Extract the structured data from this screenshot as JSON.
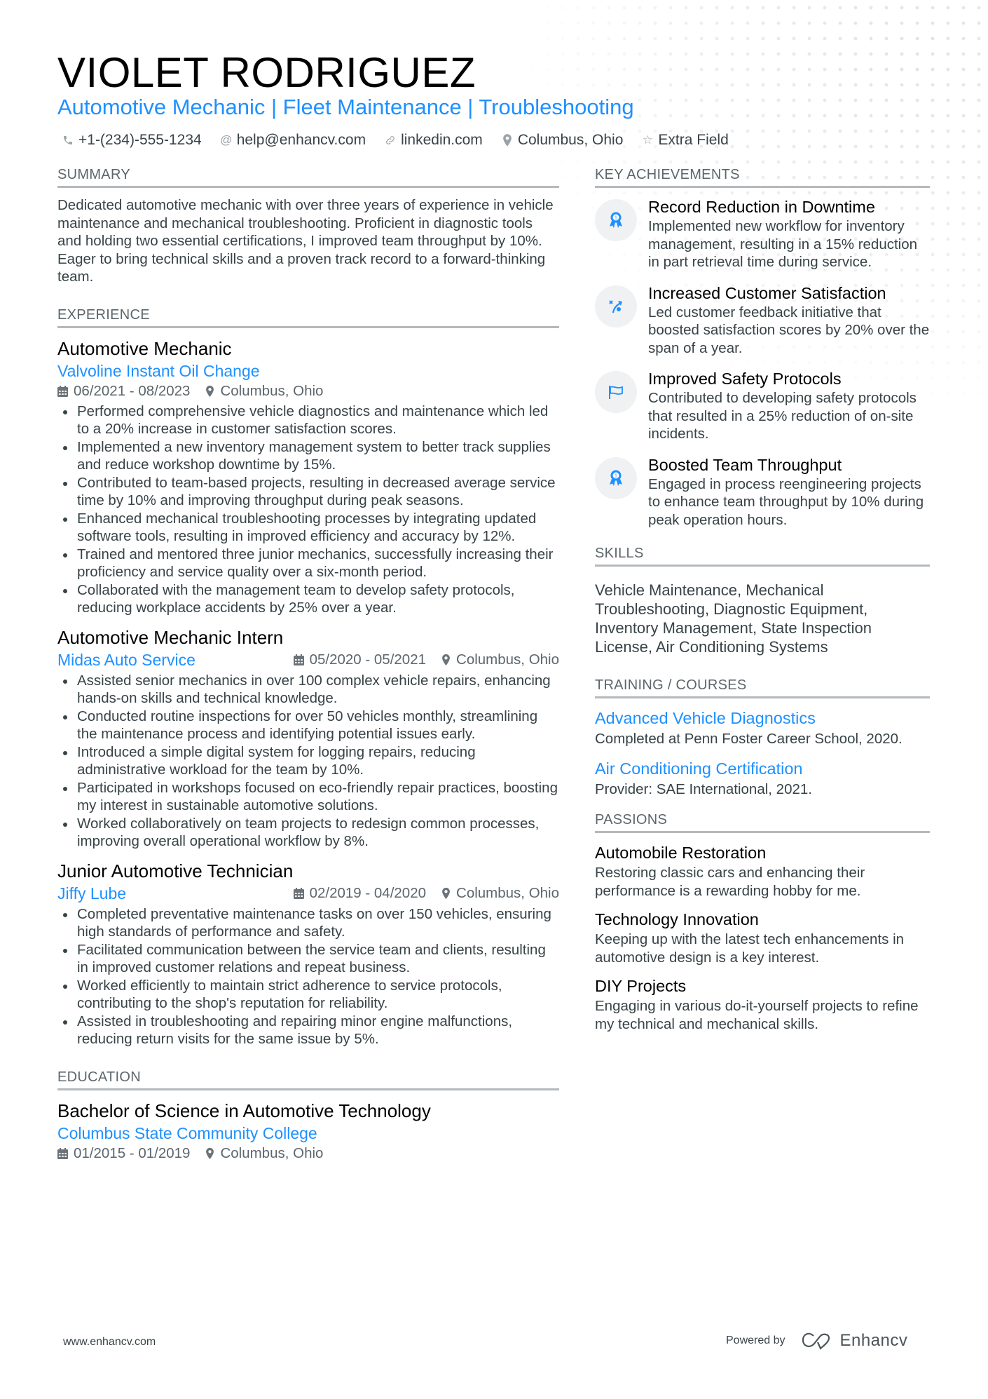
{
  "header": {
    "name": "VIOLET RODRIGUEZ",
    "headline": "Automotive Mechanic | Fleet Maintenance | Troubleshooting",
    "contacts": [
      {
        "icon": "phone-icon",
        "text": "+1-(234)-555-1234"
      },
      {
        "icon": "at-icon",
        "text": "help@enhancv.com"
      },
      {
        "icon": "link-icon",
        "text": "linkedin.com"
      },
      {
        "icon": "location-pin-icon",
        "text": "Columbus, Ohio"
      },
      {
        "icon": "star-icon",
        "text": "Extra Field"
      }
    ]
  },
  "colors": {
    "accent": "#1e90ff",
    "text": "#384347",
    "muted": "#5c666b",
    "rule": "#b5b9bc",
    "icon_bg": "#f0f1f2"
  },
  "summary": {
    "title": "SUMMARY",
    "text": "Dedicated automotive mechanic with over three years of experience in vehicle maintenance and mechanical troubleshooting. Proficient in diagnostic tools and holding two essential certifications, I improved team throughput by 10%. Eager to bring technical skills and a proven track record to a forward-thinking team."
  },
  "experience": {
    "title": "EXPERIENCE",
    "jobs": [
      {
        "title": "Automotive Mechanic",
        "company": "Valvoline Instant Oil Change",
        "dates": "06/2021 - 08/2023",
        "location": "Columbus, Ohio",
        "bullets": [
          "Performed comprehensive vehicle diagnostics and maintenance which led to a 20% increase in customer satisfaction scores.",
          "Implemented a new inventory management system to better track supplies and reduce workshop downtime by 15%.",
          "Contributed to team-based projects, resulting in decreased average service time by 10% and improving throughput during peak seasons.",
          "Enhanced mechanical troubleshooting processes by integrating updated software tools, resulting in improved efficiency and accuracy by 12%.",
          "Trained and mentored three junior mechanics, successfully increasing their proficiency and service quality over a six-month period.",
          "Collaborated with the management team to develop safety protocols, reducing workplace accidents by 25% over a year."
        ]
      },
      {
        "title": "Automotive Mechanic Intern",
        "company": "Midas Auto Service",
        "dates": "05/2020 - 05/2021",
        "location": "Columbus, Ohio",
        "bullets": [
          "Assisted senior mechanics in over 100 complex vehicle repairs, enhancing hands-on skills and technical knowledge.",
          "Conducted routine inspections for over 50 vehicles monthly, streamlining the maintenance process and identifying potential issues early.",
          "Introduced a simple digital system for logging repairs, reducing administrative workload for the team by 10%.",
          "Participated in workshops focused on eco-friendly repair practices, boosting my interest in sustainable automotive solutions.",
          "Worked collaboratively on team projects to redesign common processes, improving overall operational workflow by 8%."
        ]
      },
      {
        "title": "Junior Automotive Technician",
        "company": "Jiffy Lube",
        "dates": "02/2019 - 04/2020",
        "location": "Columbus, Ohio",
        "bullets": [
          "Completed preventative maintenance tasks on over 150 vehicles, ensuring high standards of performance and safety.",
          "Facilitated communication between the service team and clients, resulting in improved customer relations and repeat business.",
          "Worked efficiently to maintain strict adherence to service protocols, contributing to the shop's reputation for reliability.",
          "Assisted in troubleshooting and repairing minor engine malfunctions, reducing return visits for the same issue by 5%."
        ]
      }
    ]
  },
  "education": {
    "title": "EDUCATION",
    "items": [
      {
        "degree": "Bachelor of Science in Automotive Technology",
        "school": "Columbus State Community College",
        "dates": "01/2015 - 01/2019",
        "location": "Columbus, Ohio"
      }
    ]
  },
  "achievements": {
    "title": "KEY ACHIEVEMENTS",
    "items": [
      {
        "icon": "award-ribbon-icon",
        "title": "Record Reduction in Downtime",
        "desc": "Implemented new workflow for inventory management, resulting in a 15% reduction in part retrieval time during service."
      },
      {
        "icon": "strategy-arrow-icon",
        "title": "Increased Customer Satisfaction",
        "desc": "Led customer feedback initiative that boosted satisfaction scores by 20% over the span of a year."
      },
      {
        "icon": "flag-icon",
        "title": "Improved Safety Protocols",
        "desc": "Contributed to developing safety protocols that resulted in a 25% reduction of on-site incidents."
      },
      {
        "icon": "award-ribbon-icon",
        "title": "Boosted Team Throughput",
        "desc": "Engaged in process reengineering projects to enhance team throughput by 10% during peak operation hours."
      }
    ]
  },
  "skills": {
    "title": "SKILLS",
    "text": "Vehicle Maintenance, Mechanical Troubleshooting, Diagnostic Equipment, Inventory Management, State Inspection License, Air Conditioning Systems"
  },
  "training": {
    "title": "TRAINING / COURSES",
    "items": [
      {
        "title": "Advanced Vehicle Diagnostics",
        "desc": "Completed at Penn Foster Career School, 2020."
      },
      {
        "title": "Air Conditioning Certification",
        "desc": "Provider: SAE International, 2021."
      }
    ]
  },
  "passions": {
    "title": "PASSIONS",
    "items": [
      {
        "title": "Automobile Restoration",
        "desc": "Restoring classic cars and enhancing their performance is a rewarding hobby for me."
      },
      {
        "title": "Technology Innovation",
        "desc": "Keeping up with the latest tech enhancements in automotive design is a key interest."
      },
      {
        "title": "DIY Projects",
        "desc": "Engaging in various do-it-yourself projects to refine my technical and mechanical skills."
      }
    ]
  },
  "footer": {
    "website": "www.enhancv.com",
    "powered_by": "Powered by",
    "brand": "Enhancv"
  }
}
